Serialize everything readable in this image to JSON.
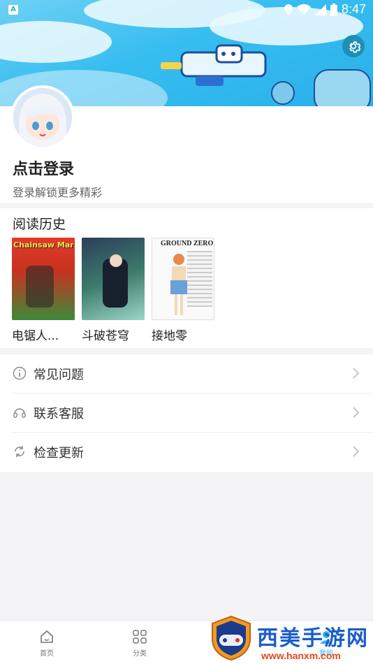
{
  "status_bar": {
    "time": "8:47"
  },
  "profile": {
    "login_title": "点击登录",
    "login_subtitle": "登录解锁更多精彩"
  },
  "history": {
    "title": "阅读历史",
    "comics": [
      {
        "title": "电锯人...",
        "cover_text": "Chainsaw Man"
      },
      {
        "title": "斗破苍穹"
      },
      {
        "title": "接地零",
        "cover_text": "GROUND ZERO"
      }
    ]
  },
  "menu": {
    "items": [
      {
        "label": "常见问题"
      },
      {
        "label": "联系客服"
      },
      {
        "label": "检查更新"
      }
    ]
  },
  "tabbar": {
    "tabs": [
      {
        "label": "首页"
      },
      {
        "label": "分类"
      },
      {
        "label": "我的"
      }
    ]
  },
  "watermark": {
    "text": "西美手游网",
    "url": "www.hanxm.com"
  },
  "colors": {
    "banner": "#36bdf0",
    "settings": "#1f8fb4",
    "watermark_blue": "#1a5dcc",
    "watermark_orange": "#e4481b"
  }
}
